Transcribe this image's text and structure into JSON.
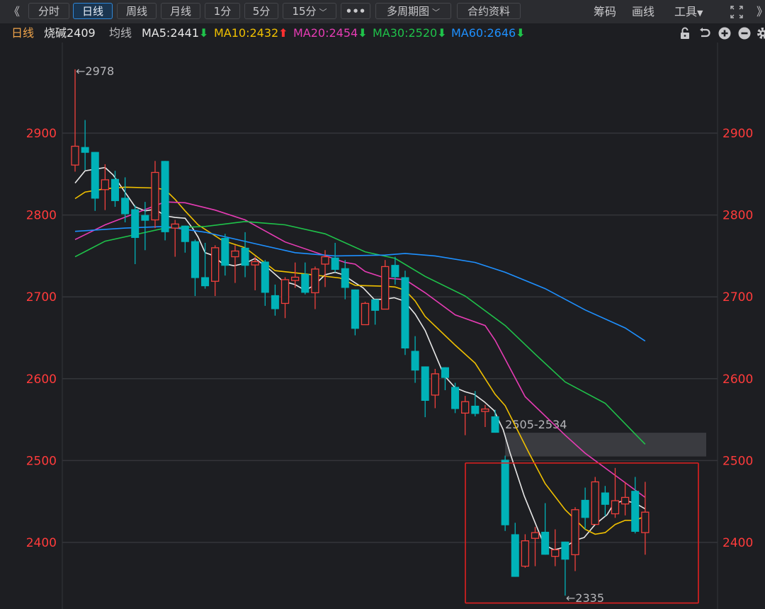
{
  "toolbar": {
    "collapse_left": "《",
    "buttons": [
      "分时",
      "日线",
      "周线",
      "月线",
      "1分",
      "5分",
      "15分",
      "•••",
      "多周期图",
      "合约资料"
    ],
    "active": "日线",
    "right": [
      "筹码",
      "画线",
      "工具"
    ],
    "expand_right": "》"
  },
  "info": {
    "period": "日线",
    "symbol": "烧碱2409",
    "ma_label": "均线",
    "ma": [
      {
        "text": "MA5:2441",
        "dir": "down",
        "color": "#e8e8e8"
      },
      {
        "text": "MA10:2432",
        "dir": "up",
        "color": "#f0c000"
      },
      {
        "text": "MA20:2454",
        "dir": "down",
        "color": "#e63cb4"
      },
      {
        "text": "MA30:2520",
        "dir": "down",
        "color": "#1fc24a"
      },
      {
        "text": "MA60:2646",
        "dir": "down",
        "color": "#1e90ff"
      }
    ],
    "arrow_down": "⬇",
    "arrow_up": "⬆",
    "icons": [
      "lock-icon",
      "undo-icon",
      "zoom-in-icon",
      "zoom-out-icon",
      "gear-icon"
    ]
  },
  "colors": {
    "up": "#f0403c",
    "down": "#00b2b8",
    "axis_text": "#ff3b3b",
    "grid": "#34353a",
    "annotation": "#b4b4b8"
  },
  "chart_data": {
    "type": "candlestick",
    "title": "烧碱2409 日线",
    "y_ticks": [
      2900,
      2800,
      2700,
      2600,
      2500,
      2400
    ],
    "ylim": [
      2318,
      2985
    ],
    "grid": true,
    "candles_ohlc": [
      [
        2861,
        2978,
        2853,
        2884
      ],
      [
        2883,
        2916,
        2855,
        2876
      ],
      [
        2877,
        2877,
        2805,
        2820
      ],
      [
        2831,
        2862,
        2806,
        2843
      ],
      [
        2844,
        2854,
        2810,
        2817
      ],
      [
        2821,
        2846,
        2791,
        2801
      ],
      [
        2807,
        2812,
        2740,
        2772
      ],
      [
        2800,
        2816,
        2757,
        2793
      ],
      [
        2794,
        2866,
        2784,
        2852
      ],
      [
        2866,
        2866,
        2769,
        2779
      ],
      [
        2784,
        2794,
        2749,
        2789
      ],
      [
        2787,
        2787,
        2754,
        2767
      ],
      [
        2768,
        2770,
        2701,
        2723
      ],
      [
        2724,
        2766,
        2710,
        2713
      ],
      [
        2719,
        2763,
        2701,
        2760
      ],
      [
        2772,
        2777,
        2726,
        2738
      ],
      [
        2749,
        2763,
        2717,
        2756
      ],
      [
        2760,
        2779,
        2724,
        2738
      ],
      [
        2739,
        2749,
        2708,
        2743
      ],
      [
        2743,
        2745,
        2689,
        2705
      ],
      [
        2702,
        2715,
        2677,
        2685
      ],
      [
        2692,
        2724,
        2674,
        2721
      ],
      [
        2720,
        2742,
        2711,
        2724
      ],
      [
        2728,
        2742,
        2703,
        2705
      ],
      [
        2705,
        2737,
        2685,
        2734
      ],
      [
        2740,
        2757,
        2712,
        2749
      ],
      [
        2748,
        2766,
        2730,
        2733
      ],
      [
        2735,
        2745,
        2697,
        2711
      ],
      [
        2709,
        2709,
        2653,
        2661
      ],
      [
        2666,
        2694,
        2666,
        2692
      ],
      [
        2697,
        2697,
        2666,
        2683
      ],
      [
        2685,
        2745,
        2685,
        2737
      ],
      [
        2739,
        2749,
        2715,
        2724
      ],
      [
        2724,
        2732,
        2629,
        2637
      ],
      [
        2634,
        2652,
        2595,
        2610
      ],
      [
        2615,
        2615,
        2553,
        2573
      ],
      [
        2580,
        2612,
        2564,
        2606
      ],
      [
        2614,
        2614,
        2586,
        2601
      ],
      [
        2590,
        2595,
        2558,
        2563
      ],
      [
        2558,
        2579,
        2531,
        2572
      ],
      [
        2567,
        2585,
        2554,
        2557
      ],
      [
        2560,
        2568,
        2541,
        2563
      ],
      [
        2554,
        2562,
        2534,
        2534
      ],
      [
        2501,
        2506,
        2414,
        2421
      ],
      [
        2410,
        2424,
        2358,
        2358
      ],
      [
        2371,
        2410,
        2369,
        2402
      ],
      [
        2405,
        2419,
        2371,
        2412
      ],
      [
        2413,
        2448,
        2385,
        2385
      ],
      [
        2383,
        2416,
        2371,
        2391
      ],
      [
        2401,
        2401,
        2335,
        2379
      ],
      [
        2385,
        2443,
        2365,
        2440
      ],
      [
        2452,
        2467,
        2416,
        2430
      ],
      [
        2422,
        2480,
        2422,
        2474
      ],
      [
        2461,
        2469,
        2432,
        2446
      ],
      [
        2435,
        2491,
        2430,
        2451
      ],
      [
        2447,
        2474,
        2433,
        2455
      ],
      [
        2463,
        2480,
        2411,
        2413
      ],
      [
        2412,
        2474,
        2385,
        2437
      ]
    ],
    "ma_series": [
      {
        "name": "MA5",
        "color": "#e8e8e8",
        "points": [
          [
            0,
            2839
          ],
          [
            1,
            2854
          ],
          [
            3,
            2858
          ],
          [
            3.8,
            2849
          ],
          [
            6,
            2810
          ],
          [
            7,
            2805
          ],
          [
            8,
            2807
          ],
          [
            9,
            2799
          ],
          [
            10,
            2797
          ],
          [
            11,
            2796
          ],
          [
            11.8,
            2783
          ],
          [
            12.3,
            2773
          ],
          [
            13,
            2754
          ],
          [
            13.7,
            2751
          ],
          [
            14.7,
            2741
          ],
          [
            15.9,
            2738
          ],
          [
            17,
            2741
          ],
          [
            18,
            2747
          ],
          [
            19.4,
            2734
          ],
          [
            20.8,
            2719
          ],
          [
            22,
            2715
          ],
          [
            23,
            2708
          ],
          [
            23.9,
            2714
          ],
          [
            25,
            2727
          ],
          [
            26,
            2730
          ],
          [
            26.8,
            2727
          ],
          [
            27.9,
            2718
          ],
          [
            28.8,
            2711
          ],
          [
            29.9,
            2697
          ],
          [
            30.9,
            2697
          ],
          [
            31.9,
            2699
          ],
          [
            32.9,
            2695
          ],
          [
            34,
            2679
          ],
          [
            35,
            2659
          ],
          [
            35.9,
            2633
          ],
          [
            36.9,
            2604
          ],
          [
            38,
            2589
          ],
          [
            39,
            2584
          ],
          [
            39.9,
            2581
          ],
          [
            40.9,
            2572
          ],
          [
            41.9,
            2561
          ],
          [
            42.8,
            2538
          ],
          [
            43.5,
            2509
          ],
          [
            44.9,
            2457
          ],
          [
            46.9,
            2397
          ],
          [
            47.9,
            2391
          ],
          [
            48.9,
            2394
          ],
          [
            50.1,
            2403
          ],
          [
            50.9,
            2406
          ],
          [
            52,
            2422
          ],
          [
            53.2,
            2434
          ],
          [
            53.9,
            2448
          ],
          [
            55,
            2451
          ],
          [
            56,
            2448
          ],
          [
            57,
            2441
          ]
        ]
      },
      {
        "name": "MA10",
        "color": "#f0c000",
        "points": [
          [
            0,
            2820
          ],
          [
            1,
            2828
          ],
          [
            3,
            2832
          ],
          [
            5,
            2834
          ],
          [
            8,
            2833
          ],
          [
            9,
            2831
          ],
          [
            10,
            2819
          ],
          [
            11,
            2805
          ],
          [
            12.3,
            2788
          ],
          [
            14.7,
            2769
          ],
          [
            17,
            2760
          ],
          [
            20,
            2732
          ],
          [
            23,
            2728
          ],
          [
            26.5,
            2723
          ],
          [
            28,
            2714
          ],
          [
            31,
            2713
          ],
          [
            32,
            2712
          ],
          [
            33,
            2708
          ],
          [
            34,
            2695
          ],
          [
            35,
            2676
          ],
          [
            38,
            2641
          ],
          [
            40,
            2619
          ],
          [
            42,
            2581
          ],
          [
            43,
            2567
          ],
          [
            45.4,
            2509
          ],
          [
            47,
            2472
          ],
          [
            49,
            2440
          ],
          [
            51,
            2416
          ],
          [
            52,
            2410
          ],
          [
            53,
            2412
          ],
          [
            54,
            2422
          ],
          [
            55,
            2427
          ],
          [
            56,
            2427
          ],
          [
            57,
            2432
          ]
        ]
      },
      {
        "name": "MA20",
        "color": "#e63cb4",
        "points": [
          [
            0,
            2770
          ],
          [
            3,
            2788
          ],
          [
            9,
            2816
          ],
          [
            11,
            2815
          ],
          [
            14,
            2806
          ],
          [
            17,
            2794
          ],
          [
            21,
            2767
          ],
          [
            27,
            2742
          ],
          [
            28,
            2740
          ],
          [
            29,
            2731
          ],
          [
            31,
            2723
          ],
          [
            33,
            2721
          ],
          [
            35,
            2705
          ],
          [
            38,
            2678
          ],
          [
            41,
            2665
          ],
          [
            42,
            2647
          ],
          [
            45,
            2578
          ],
          [
            49,
            2531
          ],
          [
            51,
            2509
          ],
          [
            55,
            2473
          ],
          [
            57,
            2455
          ]
        ]
      },
      {
        "name": "MA30",
        "color": "#1fc24a",
        "points": [
          [
            0,
            2749
          ],
          [
            3,
            2768
          ],
          [
            9,
            2784
          ],
          [
            13,
            2786
          ],
          [
            17,
            2792
          ],
          [
            21,
            2788
          ],
          [
            25,
            2777
          ],
          [
            29,
            2755
          ],
          [
            32,
            2747
          ],
          [
            35,
            2725
          ],
          [
            39,
            2701
          ],
          [
            43,
            2665
          ],
          [
            46,
            2630
          ],
          [
            49,
            2596
          ],
          [
            53,
            2570
          ],
          [
            57,
            2520
          ]
        ]
      },
      {
        "name": "MA60",
        "color": "#1e90ff",
        "points": [
          [
            0,
            2780
          ],
          [
            5,
            2784
          ],
          [
            9,
            2786
          ],
          [
            13,
            2779
          ],
          [
            18,
            2765
          ],
          [
            22,
            2754
          ],
          [
            26,
            2750
          ],
          [
            31,
            2751
          ],
          [
            33,
            2753
          ],
          [
            36,
            2750
          ],
          [
            40,
            2742
          ],
          [
            43,
            2730
          ],
          [
            47,
            2710
          ],
          [
            51,
            2684
          ],
          [
            55,
            2662
          ],
          [
            57,
            2646
          ]
        ]
      }
    ],
    "annotations": {
      "high_label": "←2978",
      "high_index": 0,
      "low_label": "←2335",
      "low_index": 49,
      "gap_zone": {
        "label": "2505-2534",
        "low": 2505,
        "high": 2534,
        "start_index": 43
      },
      "highlight_box": {
        "low": 2326,
        "high": 2497
      }
    }
  }
}
